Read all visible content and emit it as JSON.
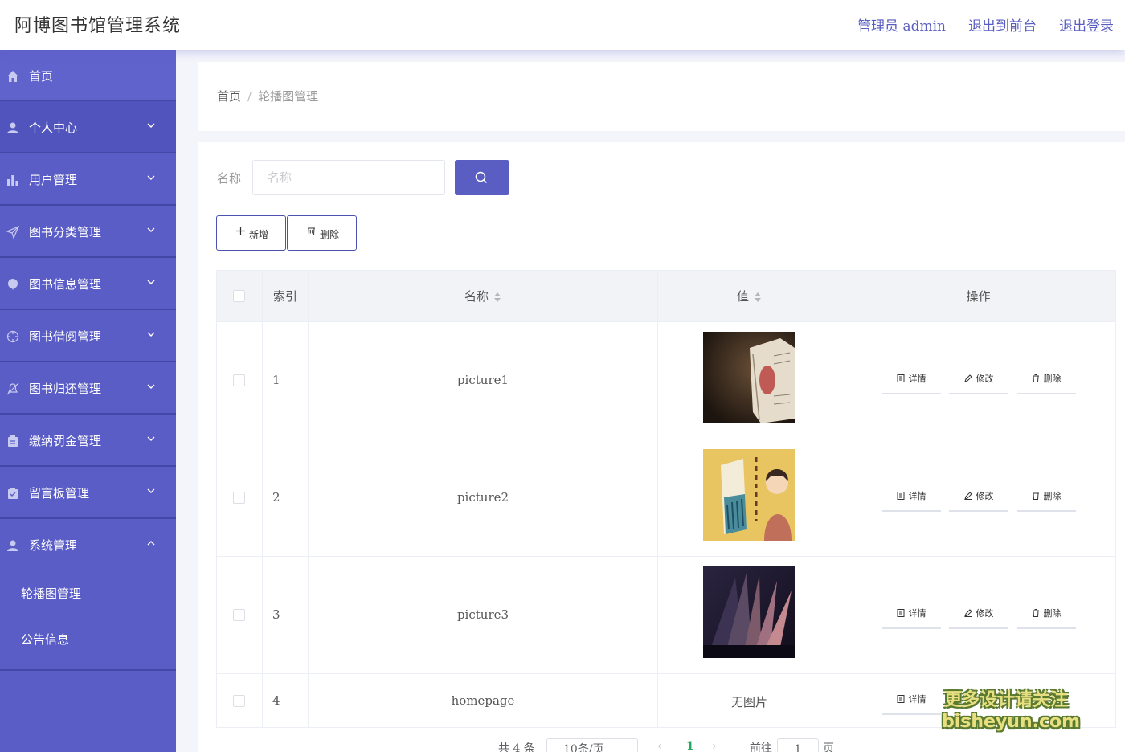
{
  "header": {
    "title": "阿博图书馆管理系统",
    "links": [
      "管理员 admin",
      "退出到前台",
      "退出登录"
    ]
  },
  "sidebar": {
    "items": [
      {
        "label": "首页",
        "icon": "home-icon"
      },
      {
        "label": "个人中心",
        "icon": "user-icon"
      },
      {
        "label": "用户管理",
        "icon": "bar-chart-icon"
      },
      {
        "label": "图书分类管理",
        "icon": "send-icon"
      },
      {
        "label": "图书信息管理",
        "icon": "balloon-icon"
      },
      {
        "label": "图书借阅管理",
        "icon": "target-icon"
      },
      {
        "label": "图书归还管理",
        "icon": "bell-off-icon"
      },
      {
        "label": "缴纳罚金管理",
        "icon": "clipboard-icon"
      },
      {
        "label": "留言板管理",
        "icon": "clipboard-check-icon"
      },
      {
        "label": "系统管理",
        "icon": "user-icon"
      }
    ],
    "submenu": [
      "轮播图管理",
      "公告信息"
    ]
  },
  "breadcrumb": {
    "home": "首页",
    "separator": "/",
    "current": "轮播图管理"
  },
  "search": {
    "label": "名称",
    "placeholder": "名称"
  },
  "toolbar": {
    "add": "新增",
    "delete": "删除"
  },
  "table": {
    "headers": {
      "index": "索引",
      "name": "名称",
      "value": "值",
      "ops": "操作"
    },
    "rows": [
      {
        "index": "1",
        "name": "picture1",
        "value": ""
      },
      {
        "index": "2",
        "name": "picture2",
        "value": ""
      },
      {
        "index": "3",
        "name": "picture3",
        "value": ""
      },
      {
        "index": "4",
        "name": "homepage",
        "value": "无图片"
      }
    ],
    "ops": {
      "detail": "详情",
      "edit": "修改",
      "delete": "删除"
    }
  },
  "pagination": {
    "total": "共 4 条",
    "page_size": "10条/页",
    "current": "1",
    "goto": "前往",
    "jump_value": "1",
    "page_suffix": "页"
  },
  "watermark": {
    "line1": "更多设计请关注",
    "line2": "bisheyun.com"
  },
  "colors": {
    "sidebar": "#5a5dc5",
    "accent": "#5a5ec2",
    "pager_active": "#27a85f"
  }
}
